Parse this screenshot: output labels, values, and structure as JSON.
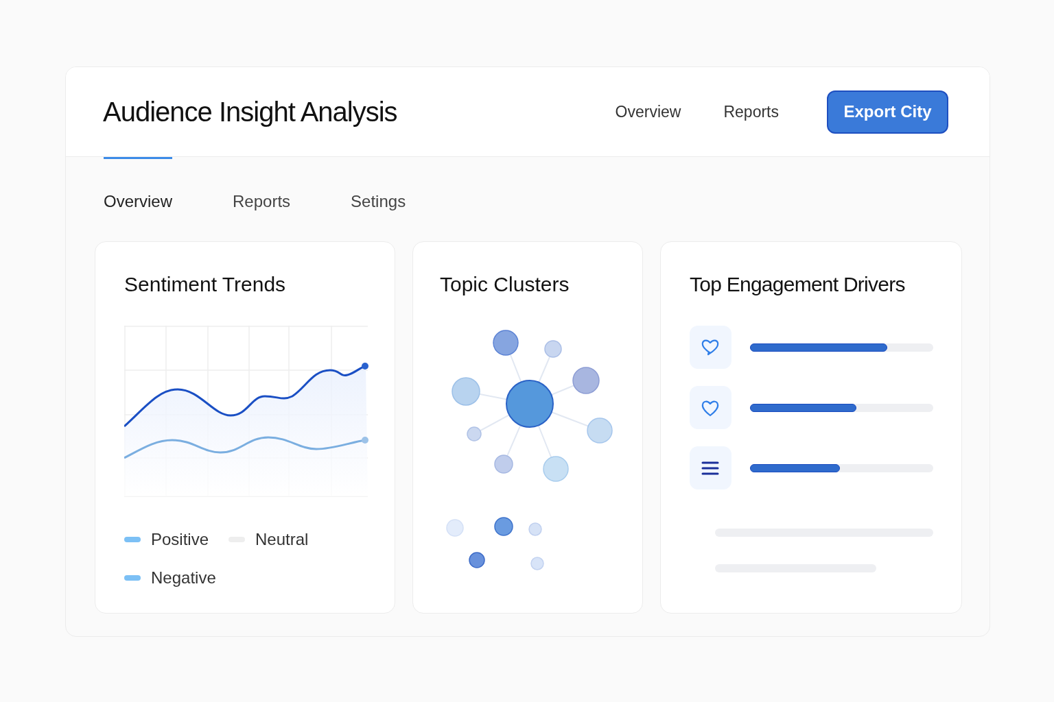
{
  "header": {
    "title": "Audience Insight Analysis",
    "nav": [
      {
        "label": "Overview"
      },
      {
        "label": "Reports"
      }
    ],
    "button": "Export City"
  },
  "tabs": [
    {
      "label": "Overview",
      "selected": true
    },
    {
      "label": "Reports",
      "selected": false
    },
    {
      "label": "Setings",
      "selected": false
    }
  ],
  "sentiment": {
    "title": "Sentiment Trends",
    "legend": [
      {
        "label": "Positive",
        "color": "#7cc0f5"
      },
      {
        "label": "Neutral",
        "color": "#eeeeee"
      },
      {
        "label": "Negative",
        "color": "#7cc0f5"
      }
    ]
  },
  "topics": {
    "title": "Topic Clusters"
  },
  "drivers": {
    "title": "Top Engagement Drivers",
    "items": [
      {
        "kind": "comment",
        "level": 0.75
      },
      {
        "kind": "like",
        "level": 0.58
      },
      {
        "kind": "list",
        "level": 0.49
      }
    ]
  }
}
